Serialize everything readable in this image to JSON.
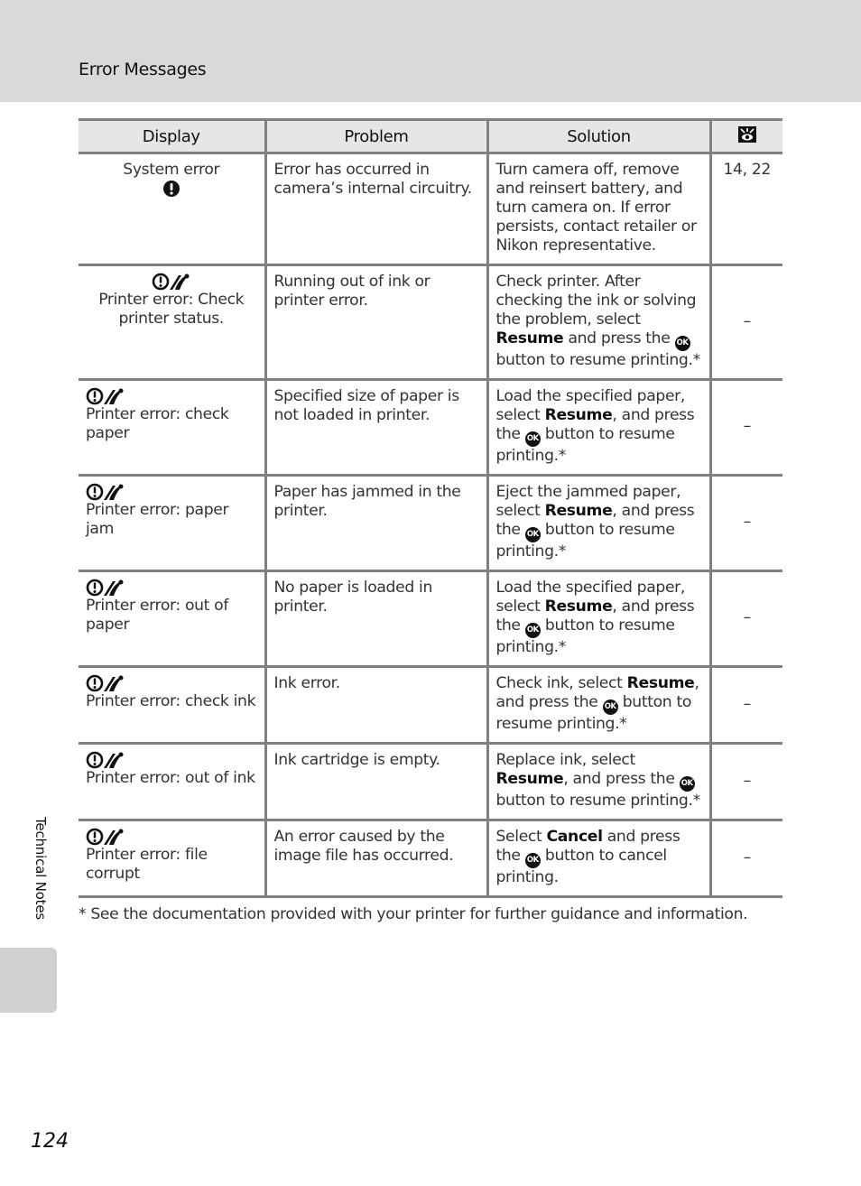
{
  "header": {
    "section_title": "Error Messages"
  },
  "table": {
    "columns": [
      "Display",
      "Problem",
      "Solution",
      "reference-icon"
    ],
    "rows": [
      {
        "display": "System error",
        "display_icon": "warning-exclamation-icon",
        "problem": "Error has occurred in camera’s internal circuitry.",
        "solution": [
          {
            "t": "Turn camera off, remove and reinsert battery, and turn camera on. If error persists, contact retailer or Nikon representative."
          }
        ],
        "ref": "14, 22"
      },
      {
        "display": "Printer error: Check printer status.",
        "display_icon": "printer-error-icon",
        "problem": "Running out of ink or printer error.",
        "solution": [
          {
            "t": "Check printer. After checking the ink or solving the problem, select "
          },
          {
            "b": "Resume"
          },
          {
            "t": " and press the "
          },
          {
            "ok": "OK"
          },
          {
            "t": " button to resume printing.*"
          }
        ],
        "ref": "–"
      },
      {
        "display": "Printer error: check paper",
        "display_icon": "printer-error-icon",
        "problem": "Specified size of paper is not loaded in printer.",
        "solution": [
          {
            "t": "Load the specified paper, select "
          },
          {
            "b": "Resume"
          },
          {
            "t": ", and press the "
          },
          {
            "ok": "OK"
          },
          {
            "t": " button to resume printing.*"
          }
        ],
        "ref": "–"
      },
      {
        "display": "Printer error: paper jam",
        "display_icon": "printer-error-icon",
        "problem": "Paper has jammed in the printer.",
        "solution": [
          {
            "t": "Eject the jammed paper, select "
          },
          {
            "b": "Resume"
          },
          {
            "t": ", and press the "
          },
          {
            "ok": "OK"
          },
          {
            "t": " button to resume printing.*"
          }
        ],
        "ref": "–"
      },
      {
        "display": "Printer error: out of paper",
        "display_icon": "printer-error-icon",
        "problem": "No paper is loaded in printer.",
        "solution": [
          {
            "t": "Load the specified paper, select "
          },
          {
            "b": "Resume"
          },
          {
            "t": ", and press the "
          },
          {
            "ok": "OK"
          },
          {
            "t": " button to resume printing.*"
          }
        ],
        "ref": "–"
      },
      {
        "display": "Printer error: check ink",
        "display_icon": "printer-error-icon",
        "problem": "Ink error.",
        "solution": [
          {
            "t": "Check ink, select "
          },
          {
            "b": "Resume"
          },
          {
            "t": ", and press the "
          },
          {
            "ok": "OK"
          },
          {
            "t": " button to resume printing.*"
          }
        ],
        "ref": "–"
      },
      {
        "display": "Printer error: out of ink",
        "display_icon": "printer-error-icon",
        "problem": "Ink cartridge is empty.",
        "solution": [
          {
            "t": "Replace ink, select "
          },
          {
            "b": "Resume"
          },
          {
            "t": ", and press the "
          },
          {
            "ok": "OK"
          },
          {
            "t": " button to resume printing.*"
          }
        ],
        "ref": "–"
      },
      {
        "display": "Printer error: file corrupt",
        "display_icon": "printer-error-icon",
        "problem": "An error caused by the image file has occurred.",
        "solution": [
          {
            "t": "Select "
          },
          {
            "b": "Cancel"
          },
          {
            "t": " and press the "
          },
          {
            "ok": "OK"
          },
          {
            "t": " button to cancel printing."
          }
        ],
        "ref": "–"
      }
    ]
  },
  "footnote": "*  See the documentation provided with your printer for further guidance and information.",
  "side_label": "Technical Notes",
  "page_number": "124"
}
